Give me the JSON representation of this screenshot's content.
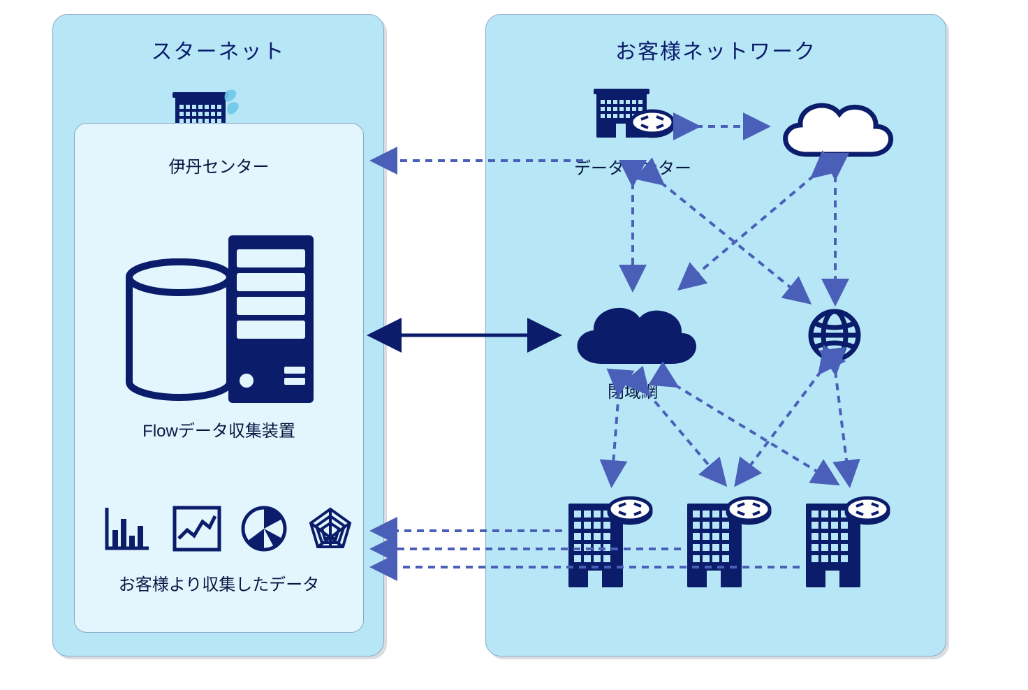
{
  "left_panel": {
    "title": "スターネット",
    "center_label": "伊丹センター",
    "flow_label": "Flowデータ収集装置",
    "collected_label": "お客様より収集したデータ"
  },
  "right_panel": {
    "title": "お客様ネットワーク",
    "datacenter_label": "データセンター",
    "closed_network_label": "閉域網"
  },
  "colors": {
    "navy": "#0b1c6b",
    "deep_navy": "#071a63",
    "panel_bg": "#b7e7f7",
    "inner_bg": "#e3f6fd",
    "dash": "#4a5fb8"
  }
}
